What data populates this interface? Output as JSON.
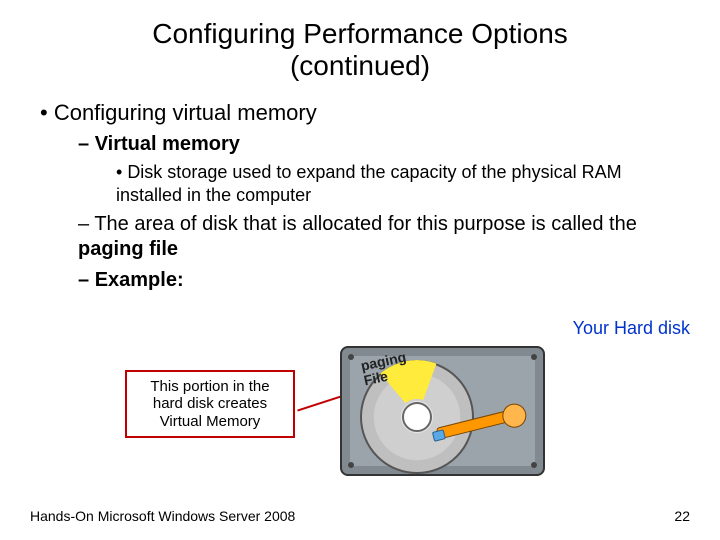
{
  "title_line1": "Configuring Performance Options",
  "title_line2": "(continued)",
  "bullets": {
    "lvl1": "Configuring virtual memory",
    "lvl2_a": "Virtual memory",
    "lvl3_a": "Disk storage used to expand the capacity of the physical RAM installed in the computer",
    "lvl2_b_pre": "The area of disk that is allocated for this purpose is called the ",
    "lvl2_b_bold": "paging file",
    "lvl2_c": "Example:"
  },
  "diagram": {
    "hdd_label": "Your Hard disk",
    "callout_l1": "This portion in the",
    "callout_l2": "hard disk creates",
    "callout_l3": "Virtual Memory",
    "paging_l1": "paging",
    "paging_l2": "File"
  },
  "footer": {
    "left": "Hands-On Microsoft Windows Server 2008",
    "right": "22"
  }
}
